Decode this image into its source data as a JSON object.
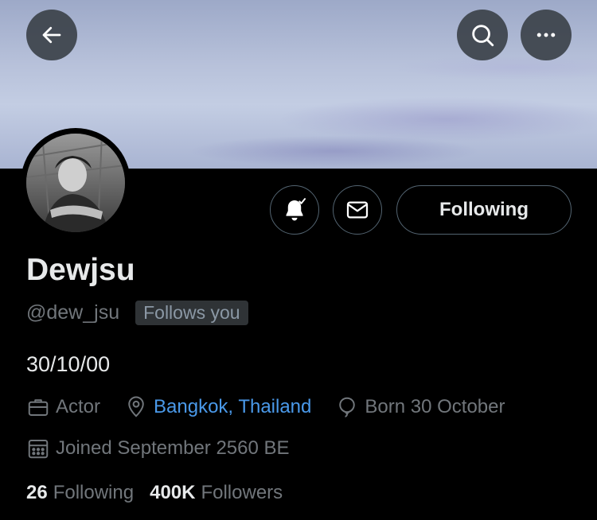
{
  "header": {
    "back_icon": "arrow-left-icon",
    "search_icon": "search-icon",
    "more_icon": "more-horizontal-icon"
  },
  "profile": {
    "display_name": "Dewjsu",
    "handle": "@dew_jsu",
    "follows_you_badge": "Follows you",
    "bio": "30/10/00",
    "profession": "Actor",
    "location": "Bangkok, Thailand",
    "birthday": "Born 30 October",
    "joined": "Joined September 2560 BE"
  },
  "actions": {
    "notify_icon": "bell-check-icon",
    "message_icon": "envelope-icon",
    "follow_state_label": "Following"
  },
  "stats": {
    "following_count": "26",
    "following_label": "Following",
    "followers_count": "400K",
    "followers_label": "Followers"
  },
  "colors": {
    "background": "#000000",
    "text_primary": "#e7e9ea",
    "text_secondary": "#71767b",
    "link": "#4a99e9",
    "border": "#536471"
  }
}
